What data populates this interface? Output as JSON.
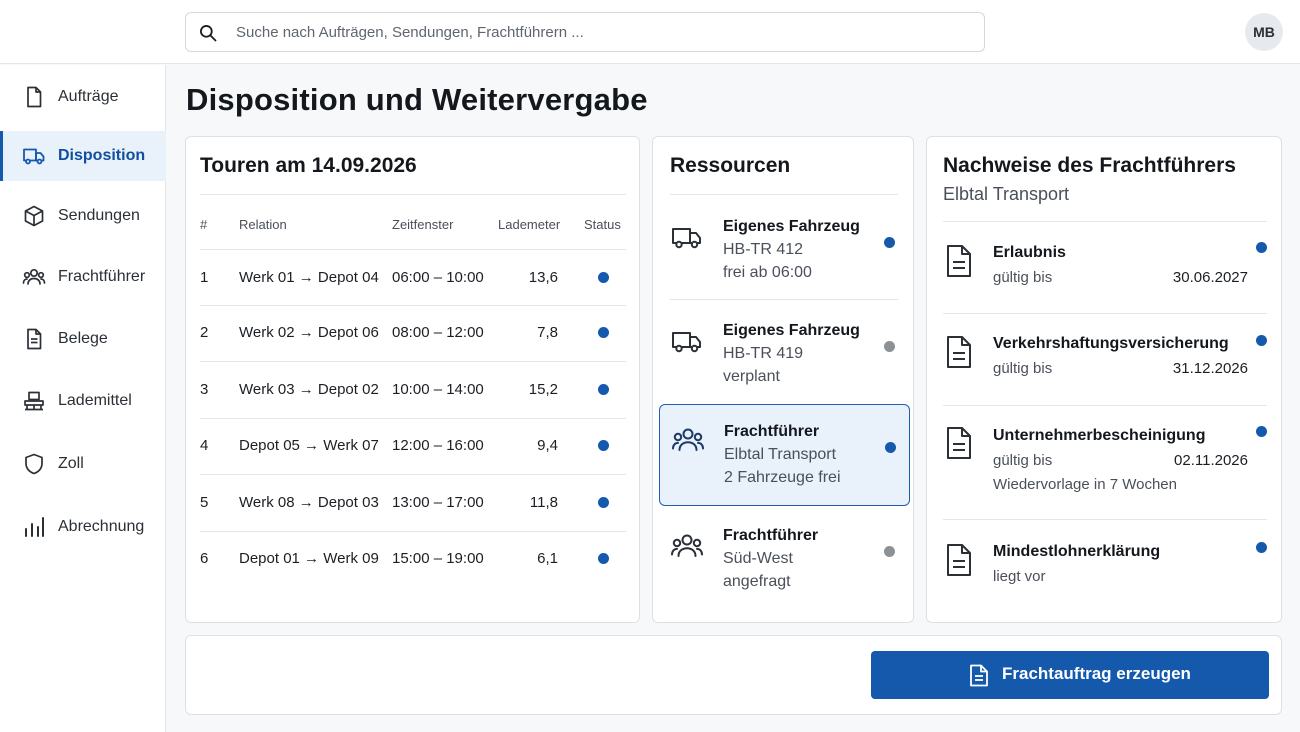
{
  "search": {
    "placeholder": "Suche nach Aufträgen, Sendungen, Frachtführern ..."
  },
  "user": {
    "initials": "MB"
  },
  "sidebar": {
    "items": [
      {
        "label": "Aufträge",
        "icon": "document-icon"
      },
      {
        "label": "Disposition",
        "icon": "truck-icon"
      },
      {
        "label": "Sendungen",
        "icon": "package-icon"
      },
      {
        "label": "Frachtführer",
        "icon": "users-icon"
      },
      {
        "label": "Belege",
        "icon": "receipt-icon"
      },
      {
        "label": "Lademittel",
        "icon": "pallet-icon"
      },
      {
        "label": "Zoll",
        "icon": "shield-icon"
      },
      {
        "label": "Abrechnung",
        "icon": "bar-chart-icon"
      }
    ],
    "active": "Disposition"
  },
  "page": {
    "title": "Disposition und Weitervergabe"
  },
  "tours": {
    "title": "Touren am 14.09.2026",
    "headers": {
      "num": "#",
      "relation": "Relation",
      "window": "Zeitfenster",
      "meters": "Lademeter",
      "status": "Status"
    },
    "rows": [
      {
        "num": "1",
        "relation": "Werk 01 → Depot 04",
        "window": "06:00 – 10:00",
        "meters": "13,6"
      },
      {
        "num": "2",
        "relation": "Werk 02 → Depot 06",
        "window": "08:00 – 12:00",
        "meters": "7,8"
      },
      {
        "num": "3",
        "relation": "Werk 03 → Depot 02",
        "window": "10:00 – 14:00",
        "meters": "15,2"
      },
      {
        "num": "4",
        "relation": "Depot 05 → Werk 07",
        "window": "12:00 – 16:00",
        "meters": "9,4"
      },
      {
        "num": "5",
        "relation": "Werk 08 → Depot 03",
        "window": "13:00 – 17:00",
        "meters": "11,8"
      },
      {
        "num": "6",
        "relation": "Depot 01 → Werk 09",
        "window": "15:00 – 19:00",
        "meters": "6,1"
      }
    ],
    "status_color": "#1559ad"
  },
  "resources": {
    "title": "Ressourcen",
    "items": [
      {
        "type": "Eigenes Fahrzeug",
        "name": "HB-TR 412",
        "state": "frei ab 06:00",
        "icon": "truck-icon",
        "status_color": "#1559ad"
      },
      {
        "type": "Eigenes Fahrzeug",
        "name": "HB-TR 419",
        "state": "verplant",
        "icon": "truck-icon",
        "status_color": "#8c9196"
      },
      {
        "type": "Frachtführer",
        "name": "Elbtal Transport",
        "state": "2 Fahrzeuge frei",
        "icon": "users-icon",
        "status_color": "#1559ad",
        "selected": true
      },
      {
        "type": "Frachtführer",
        "name": "Süd-West",
        "state": "angefragt",
        "icon": "users-icon",
        "status_color": "#8c9196"
      }
    ]
  },
  "documents": {
    "title": "Nachweise des Frachtführers",
    "carrier": "Elbtal Transport",
    "items": [
      {
        "title": "Erlaubnis",
        "label": "gültig bis",
        "date": "30.06.2027",
        "note": ""
      },
      {
        "title": "Verkehrshaftungsversicherung",
        "label": "gültig bis",
        "date": "31.12.2026",
        "note": ""
      },
      {
        "title": "Unternehmerbescheinigung",
        "label": "gültig bis",
        "date": "02.11.2026",
        "note": "Wiedervorlage in 7 Wochen"
      },
      {
        "title": "Mindestlohnerklärung",
        "label": "liegt vor",
        "date": "",
        "note": ""
      }
    ]
  },
  "actions": {
    "primary_label": "Frachtauftrag erzeugen",
    "primary_icon": "document-icon"
  },
  "colors": {
    "accent": "#1559ad",
    "accent_light": "#e9f1fb",
    "muted_dot": "#8c9196"
  }
}
